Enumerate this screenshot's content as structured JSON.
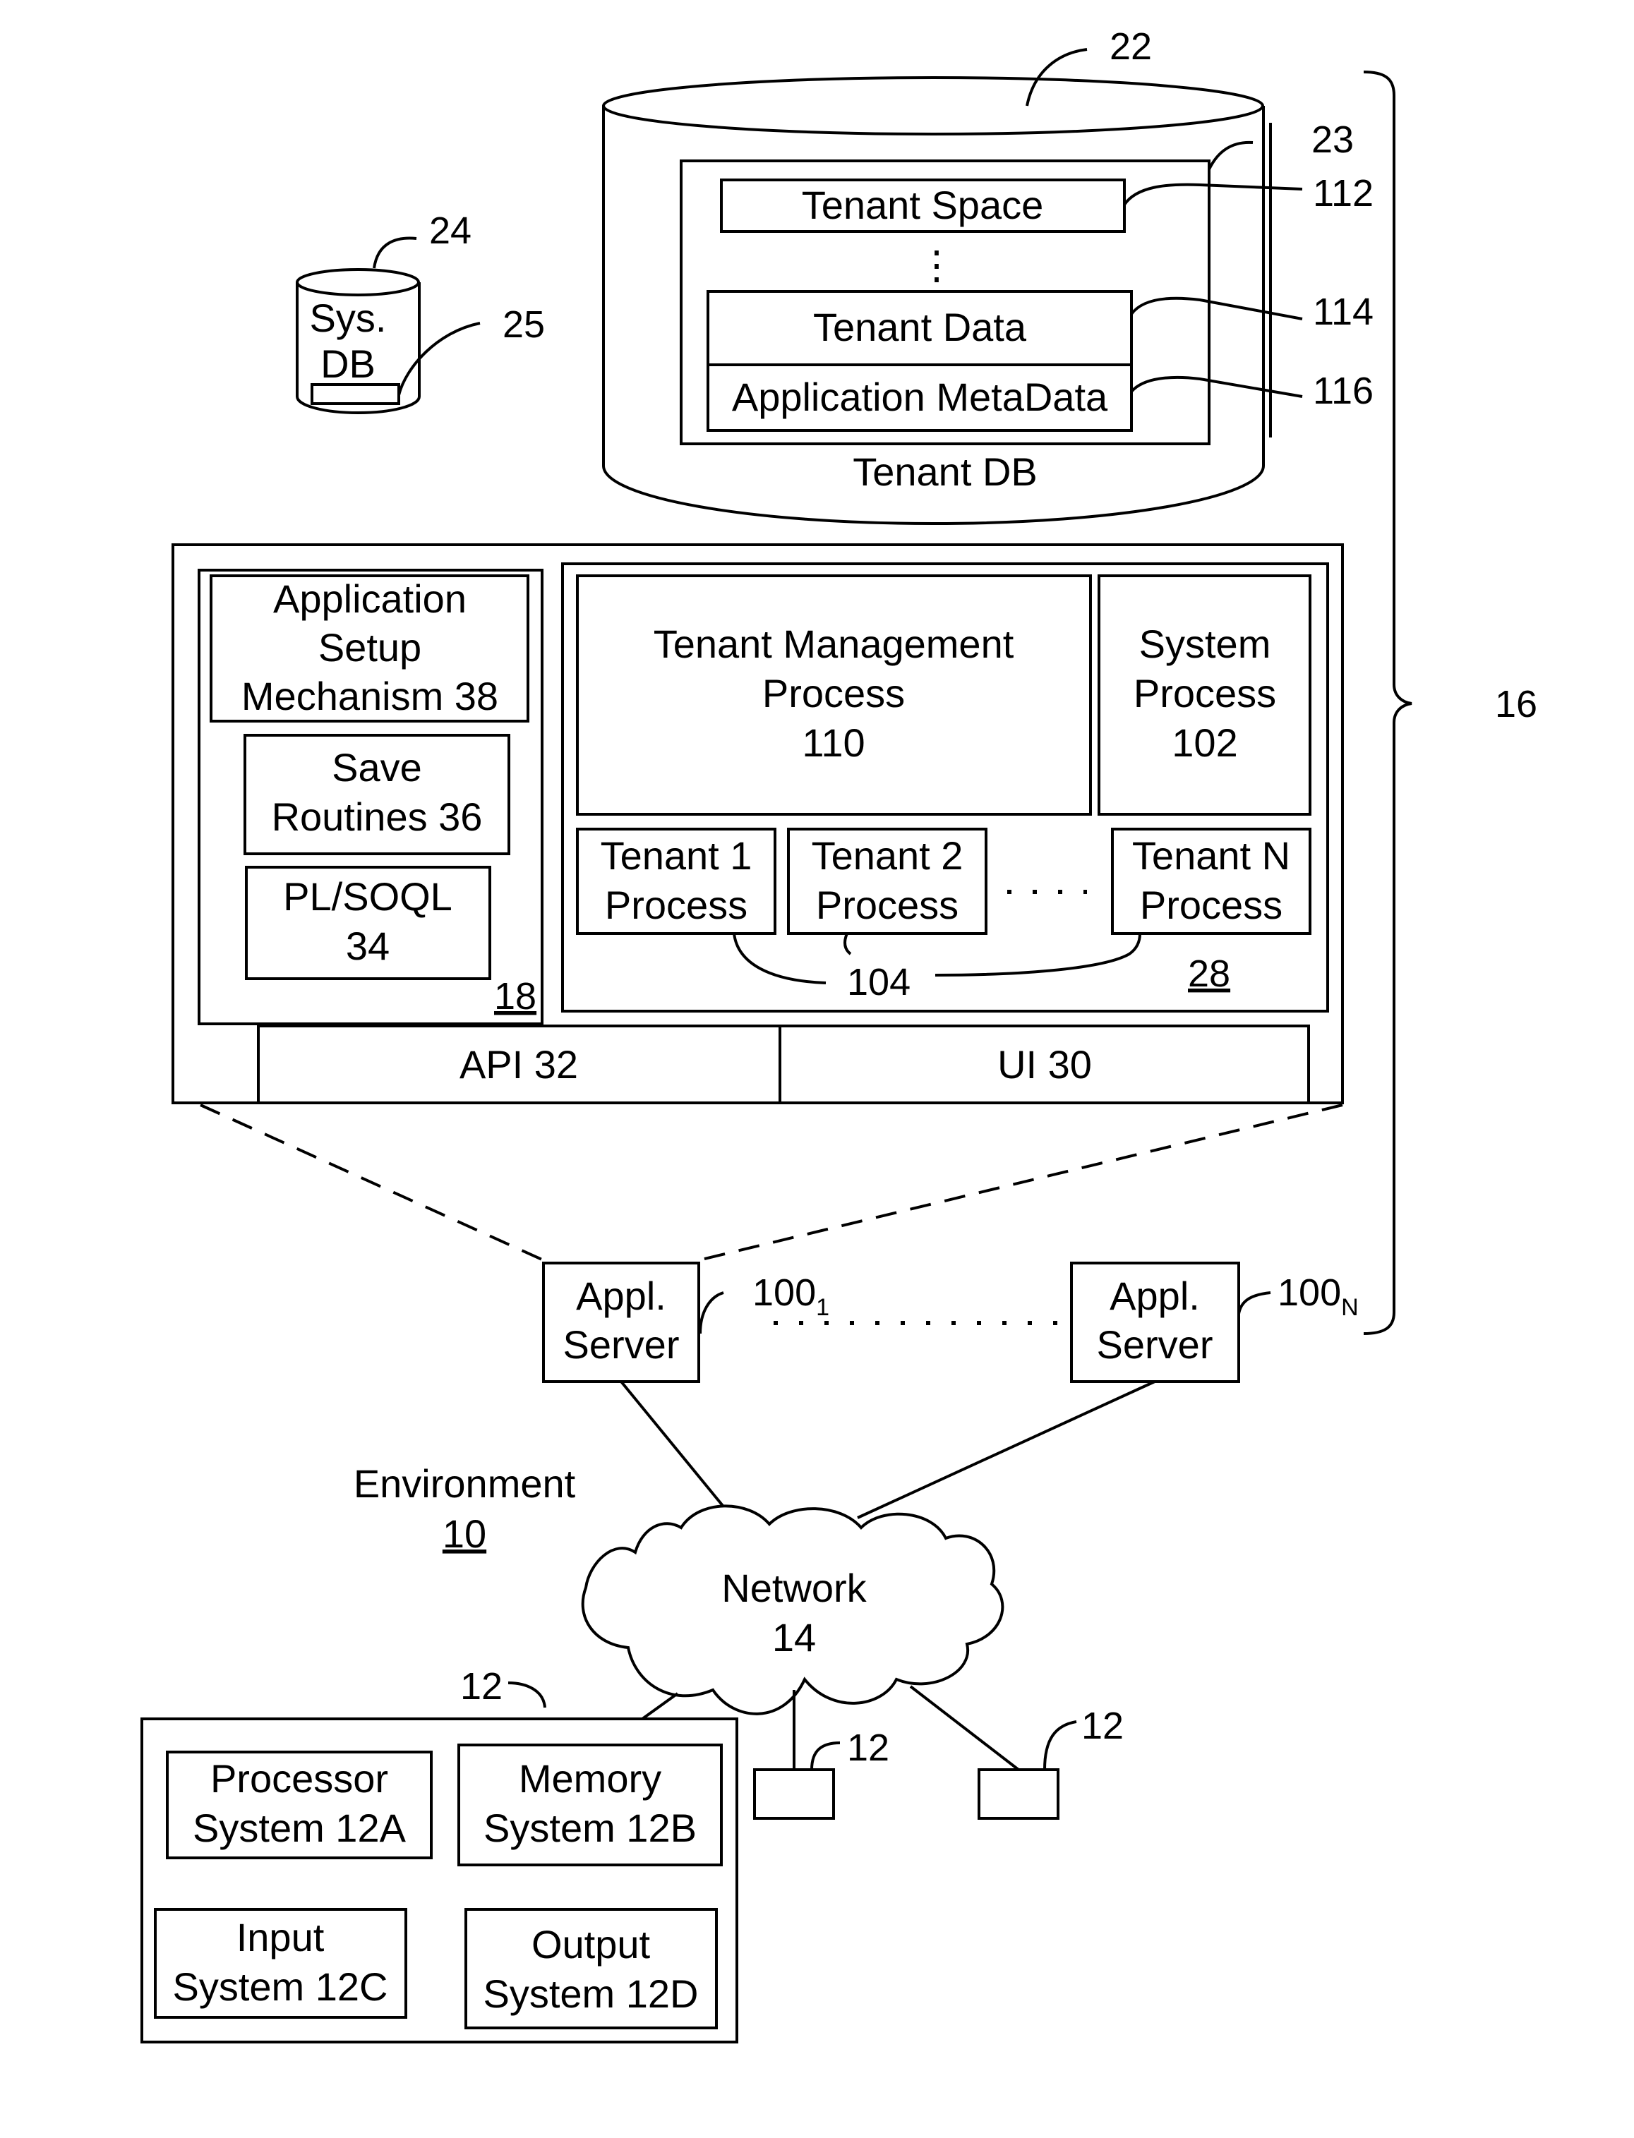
{
  "figure": {
    "environment": {
      "label": "Environment",
      "ref": "10"
    },
    "system_ref": "16",
    "tenant_db": {
      "ref": "22",
      "label": "Tenant DB",
      "storage_ref": "23",
      "tenant_space": {
        "label": "Tenant Space",
        "ref": "112"
      },
      "tenant_data": {
        "label": "Tenant Data",
        "ref": "114"
      },
      "app_metadata": {
        "label": "Application MetaData",
        "ref": "116"
      },
      "ellipsis": "⋮"
    },
    "sys_db": {
      "ref": "24",
      "line1": "Sys.",
      "line2": "DB",
      "item_ref": "25"
    },
    "app_platform": {
      "ref": "18",
      "setup": {
        "line1": "Application",
        "line2": "Setup",
        "line3": "Mechanism 38"
      },
      "save": {
        "line1": "Save",
        "line2": "Routines 36"
      },
      "plsoql": {
        "line1": "PL/SOQL",
        "line2": "34"
      }
    },
    "process_space": {
      "ref": "28",
      "tenant_mgmt": {
        "line1": "Tenant Management",
        "line2": "Process",
        "line3": "110"
      },
      "system_process": {
        "line1": "System",
        "line2": "Process",
        "line3": "102"
      },
      "tenant_processes": [
        {
          "line1": "Tenant 1",
          "line2": "Process"
        },
        {
          "line1": "Tenant 2",
          "line2": "Process"
        },
        {
          "line1": "Tenant N",
          "line2": "Process"
        }
      ],
      "tenant_process_ref": "104",
      "ellipsis": "· · · ·"
    },
    "api": {
      "label": "API 32"
    },
    "ui": {
      "label": "UI 30"
    },
    "app_servers": [
      {
        "line1": "Appl.",
        "line2": "Server",
        "ref": "100",
        "sub": "1"
      },
      {
        "line1": "Appl.",
        "line2": "Server",
        "ref": "100",
        "sub": "N"
      }
    ],
    "network": {
      "line1": "Network",
      "line2": "14"
    },
    "user_system": {
      "ref": "12",
      "processor": {
        "line1": "Processor",
        "line2": "System 12A"
      },
      "memory": {
        "line1": "Memory",
        "line2": "System 12B"
      },
      "input": {
        "line1": "Input",
        "line2": "System 12C"
      },
      "output": {
        "line1": "Output",
        "line2": "System 12D"
      }
    },
    "other_user_systems": [
      {
        "ref": "12"
      },
      {
        "ref": "12"
      }
    ]
  }
}
